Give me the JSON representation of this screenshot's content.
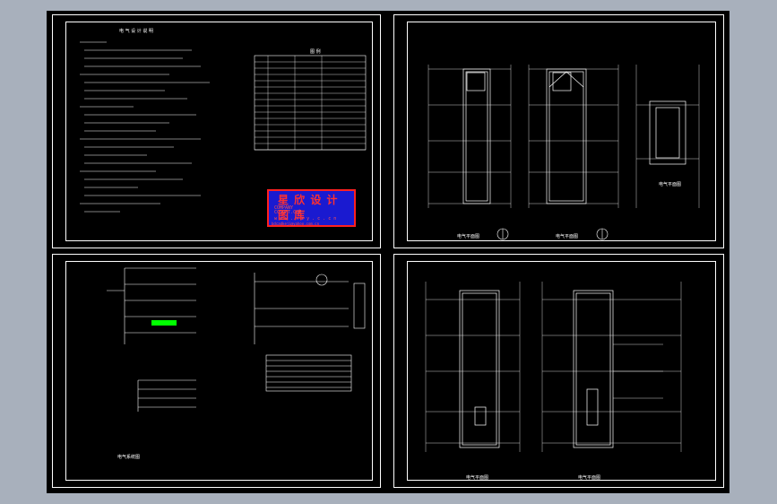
{
  "sheets": {
    "s1_title": "电 气 设 计 说 明",
    "s1_table_title": "图 例",
    "s2_labels": [
      "电气平面图",
      "电气平面图",
      "电气平面图"
    ],
    "s3_label": "电气系统图",
    "s4_labels": [
      "电气平面图",
      "电气平面图"
    ]
  },
  "logo": {
    "name": "星 欣 设 计 图 库",
    "line1": "COMPANY",
    "line2": "CCSOFT.COM",
    "url": "w w w . x z y . c . c n",
    "email": "bdcadkeji@yahoo.com.cn"
  },
  "colors": {
    "background": "#a8b0bc",
    "canvas": "#000000",
    "lines": "#ffffff",
    "logo_bg": "#1a1ad0",
    "logo_border": "#ff2020",
    "highlight": "#00ff00"
  }
}
